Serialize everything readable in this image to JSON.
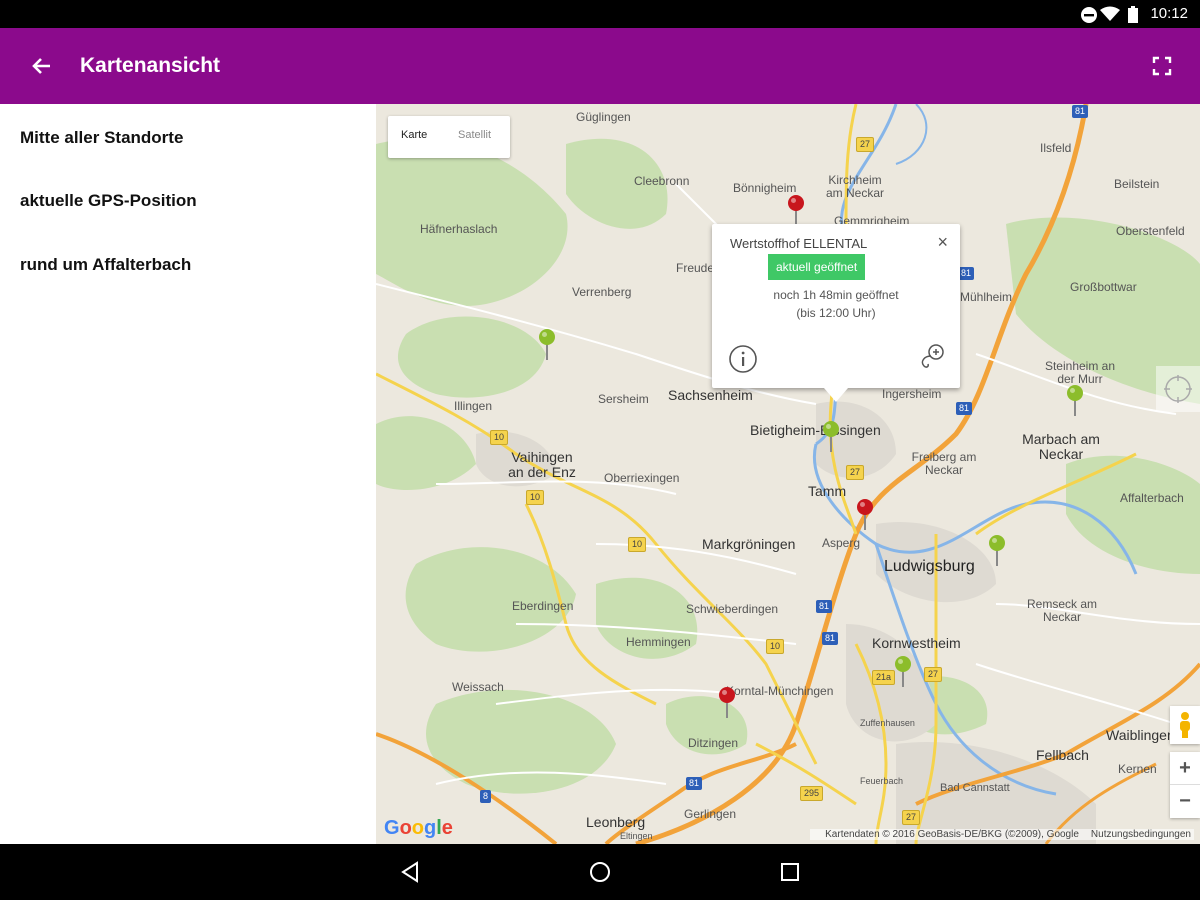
{
  "status_bar": {
    "time": "10:12"
  },
  "app_bar": {
    "title": "Kartenansicht"
  },
  "sidebar": {
    "items": [
      {
        "label": "Mitte aller Standorte"
      },
      {
        "label": "aktuelle GPS-Position"
      },
      {
        "label": "rund um Affalterbach"
      }
    ]
  },
  "map": {
    "type_control": {
      "map_label": "Karte",
      "satellite_label": "Satellit"
    },
    "places": [
      "Güglingen",
      "Cleebronn",
      "Bönnigheim",
      "Kirchheim am Neckar",
      "Gemmrigheim",
      "Ilsfeld",
      "Beilstein",
      "Oberstenfeld",
      "Großbottwar",
      "Häfnerhaslach",
      "Freudental",
      "Verrenberg",
      "Sersheim",
      "Sachsenheim",
      "Ingersheim",
      "Illingen",
      "Bietigheim-Bissingen",
      "Steinheim an der Murr",
      "Marbach am Neckar",
      "Vaihingen an der Enz",
      "Oberriexingen",
      "Freiberg am Neckar",
      "Tamm",
      "Affalterbach",
      "Markgröningen",
      "Asperg",
      "Ludwigsburg",
      "Eberdingen",
      "Schwieberdingen",
      "Remseck am Neckar",
      "Hemmingen",
      "Kornwestheim",
      "Weissach",
      "Korntal-Münchingen",
      "Ditzingen",
      "Zuffenhausen",
      "Feuerbach",
      "Fellbach",
      "Waiblingen",
      "Kernen",
      "Leonberg",
      "Gerlingen",
      "Eltingen",
      "Bad Cannstatt",
      "Mühlheim"
    ],
    "road_badges": [
      "81",
      "27",
      "81",
      "81",
      "81",
      "10",
      "10",
      "10",
      "27",
      "10",
      "81",
      "27",
      "21a",
      "8",
      "81",
      "295",
      "27"
    ],
    "popup": {
      "title": "Wertstoffhof ELLENTAL",
      "status_badge": "aktuell geöffnet",
      "line1": "noch 1h 48min geöffnet",
      "line2": "(bis 12:00 Uhr)"
    },
    "pins": [
      {
        "color": "red"
      },
      {
        "color": "green"
      },
      {
        "color": "green"
      },
      {
        "color": "green"
      },
      {
        "color": "red"
      },
      {
        "color": "green"
      },
      {
        "color": "green"
      },
      {
        "color": "red"
      }
    ],
    "colors": {
      "red_pin": "#c8161d",
      "green_pin": "#8cbd2b",
      "accent": "#8b0a8c",
      "open_badge": "#3fc866"
    },
    "zoom_in_label": "+",
    "zoom_out_label": "−",
    "attribution": "Kartendaten © 2016 GeoBasis-DE/BKG (©2009), Google",
    "terms": "Nutzungsbedingungen",
    "logo": "Google"
  }
}
